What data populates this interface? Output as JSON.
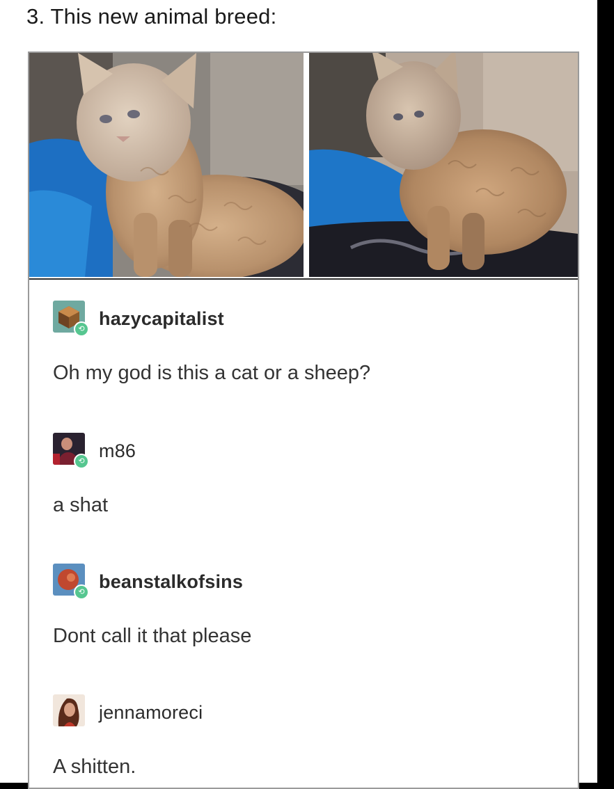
{
  "heading": "3. This new animal breed:",
  "photos": [
    {
      "alt": "cat-photo-left"
    },
    {
      "alt": "cat-photo-right"
    }
  ],
  "notes": [
    {
      "username": "hazycapitalist",
      "message": "Oh my god is this a cat or a sheep?",
      "avatar_icon": "cube-avatar-icon",
      "avatar_color": "#6fa9a0"
    },
    {
      "username": "m86",
      "message": "a shat",
      "avatar_icon": "portrait-avatar-icon",
      "avatar_color": "#2a2230"
    },
    {
      "username": "beanstalkofsins",
      "message": "Dont call it that please",
      "avatar_icon": "circle-avatar-icon",
      "avatar_color": "#5b8fbf"
    },
    {
      "username": "jennamoreci",
      "message": "A shitten.",
      "avatar_icon": "photo-avatar-icon",
      "avatar_color": "#d9a186"
    }
  ],
  "colors": {
    "reblog_badge": "#56c690",
    "border": "#9a9a9a"
  }
}
